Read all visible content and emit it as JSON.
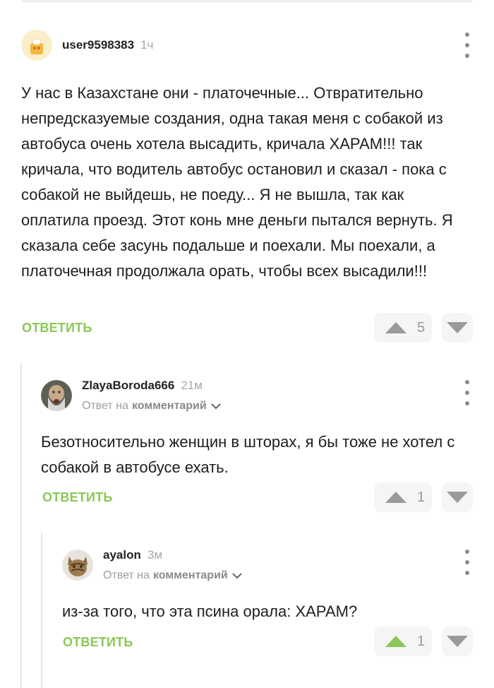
{
  "colors": {
    "accent": "#8ac858",
    "vote_icon": "#9a9a9a",
    "vote_icon_active": "#8ac858",
    "muted": "#a8a8a8",
    "thread_line": "#e6e6e6"
  },
  "comments": [
    {
      "username": "user9598383",
      "time": "1ч",
      "text": "У нас в Казахстане они - платочечные... Отвратительно непредсказуемые создания, одна такая меня с собакой из автобуса очень хотела высадить, кричала ХАРАМ!!! так кричала, что водитель автобус остановил и сказал - пока с собакой не выйдешь, не поеду... Я не вышла, так как оплатила проезд. Этот конь мне деньги пытался вернуть. Я сказала себе засунь подальше и поехали. Мы поехали, а платочечная продолжала орать, чтобы всех высадили!!!",
      "reply_label": "ОТВЕТИТЬ",
      "rating": "5",
      "up_icon": "arrow-up-icon",
      "down_icon": "arrow-down-icon",
      "menu_icon": "more-vertical-icon"
    },
    {
      "username": "ZlayaBoroda666",
      "time": "21м",
      "reply_prefix": "Ответ на",
      "reply_target": "комментарий",
      "text": "Безотносительно женщин в шторах, я бы тоже не хотел с собакой в автобусе ехать.",
      "reply_label": "ОТВЕТИТЬ",
      "rating": "1",
      "up_icon": "arrow-up-icon",
      "down_icon": "arrow-down-icon",
      "menu_icon": "more-vertical-icon"
    },
    {
      "username": "ayalon",
      "time": "3м",
      "reply_prefix": "Ответ на",
      "reply_target": "комментарий",
      "text": "из-за того, что эта псина орала: ХАРАМ?",
      "reply_label": "ОТВЕТИТЬ",
      "rating": "1",
      "upvoted": true,
      "up_icon": "arrow-up-icon",
      "down_icon": "arrow-down-icon",
      "menu_icon": "more-vertical-icon"
    }
  ]
}
